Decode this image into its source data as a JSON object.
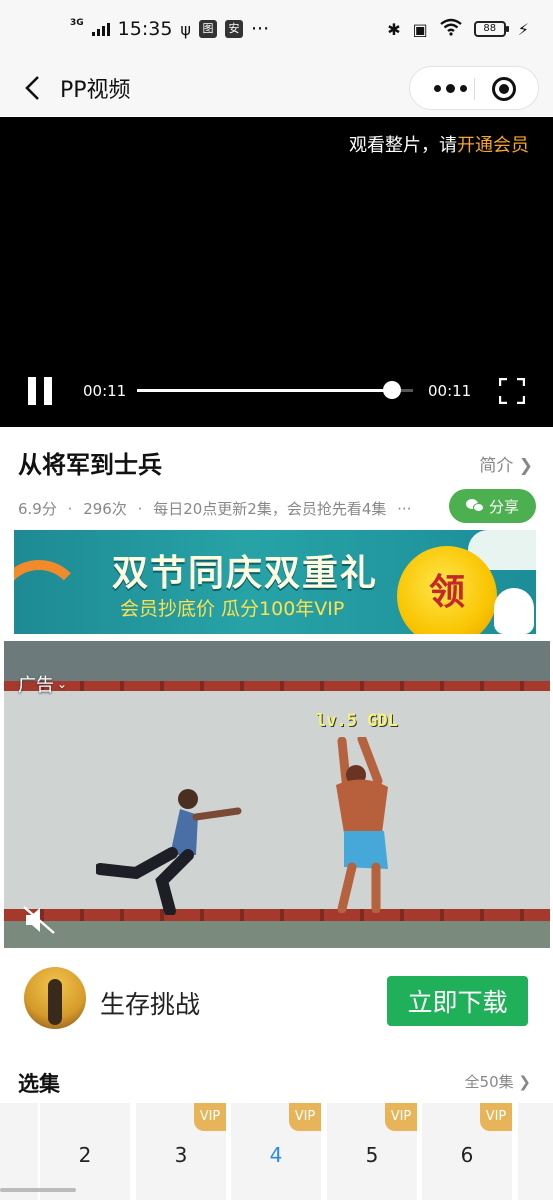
{
  "status_bar": {
    "network_type": "3G",
    "time": "15:35",
    "icon_a": "图",
    "icon_b": "安",
    "more": "···",
    "battery": "88"
  },
  "nav": {
    "title": "PP视频"
  },
  "player": {
    "vip_prompt": "观看整片，请",
    "vip_link": "开通会员",
    "current_time": "00:11",
    "total_time": "00:11",
    "progress": 0.925
  },
  "show": {
    "title": "从将军到士兵",
    "intro_label": "简介",
    "rating": "6.9分",
    "plays": "296次",
    "update_info": "每日20点更新2集，会员抢先看4集",
    "share_label": "分享"
  },
  "banner": {
    "headline": "双节同庆双重礼",
    "subline": "会员抄底价  瓜分100年VIP",
    "badge": "领"
  },
  "ad": {
    "label": "广告",
    "game_text": "lv.5 GDL"
  },
  "app": {
    "name": "生存挑战",
    "download_label": "立即下载"
  },
  "episodes": {
    "section_title": "选集",
    "all_label": "全50集",
    "items": [
      {
        "number": "2",
        "vip": "",
        "active": false
      },
      {
        "number": "3",
        "vip": "VIP",
        "active": false
      },
      {
        "number": "4",
        "vip": "VIP",
        "active": true
      },
      {
        "number": "5",
        "vip": "VIP",
        "active": false
      },
      {
        "number": "6",
        "vip": "VIP",
        "active": false
      }
    ]
  },
  "colors": {
    "accent_green": "#20b05a",
    "share_green": "#4caf50",
    "vip_gold": "#e8b45a",
    "vip_link_orange": "#f5a623",
    "active_episode_blue": "#2a8be2"
  }
}
